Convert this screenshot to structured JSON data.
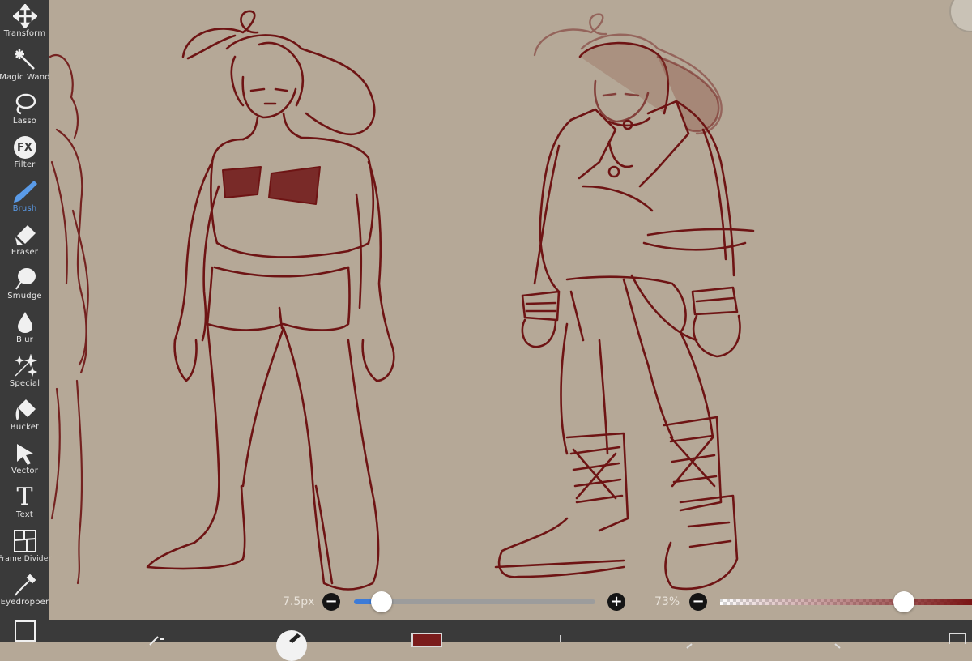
{
  "toolbar": {
    "tools": [
      {
        "label": "Transform",
        "icon": "transform-icon"
      },
      {
        "label": "Magic Wand",
        "icon": "magic-wand-icon"
      },
      {
        "label": "Lasso",
        "icon": "lasso-icon"
      },
      {
        "label": "Filter",
        "icon": "filter-fx-icon",
        "glyph": "FX"
      },
      {
        "label": "Brush",
        "icon": "brush-icon",
        "active": true
      },
      {
        "label": "Eraser",
        "icon": "eraser-icon"
      },
      {
        "label": "Smudge",
        "icon": "smudge-icon"
      },
      {
        "label": "Blur",
        "icon": "blur-drop-icon"
      },
      {
        "label": "Special",
        "icon": "special-sparkle-icon"
      },
      {
        "label": "Bucket",
        "icon": "bucket-icon"
      },
      {
        "label": "Vector",
        "icon": "vector-arrow-icon"
      },
      {
        "label": "Text",
        "icon": "text-icon",
        "glyph": "T"
      },
      {
        "label": "Frame Divider",
        "icon": "frame-divider-icon"
      },
      {
        "label": "Eyedropper",
        "icon": "eyedropper-icon"
      }
    ]
  },
  "brush_settings": {
    "size_label": "7.5px",
    "size_fraction": 0.11,
    "opacity_label": "73%",
    "opacity_fraction": 0.73,
    "minus_glyph": "−",
    "plus_glyph": "+"
  },
  "colors": {
    "canvas": "#b5a897",
    "stroke": "#6e1414",
    "toolbar": "#3a3a3a",
    "active": "#5a9be8",
    "slider_fill": "#3c7bd8",
    "current_color": "#7a1c1c"
  }
}
